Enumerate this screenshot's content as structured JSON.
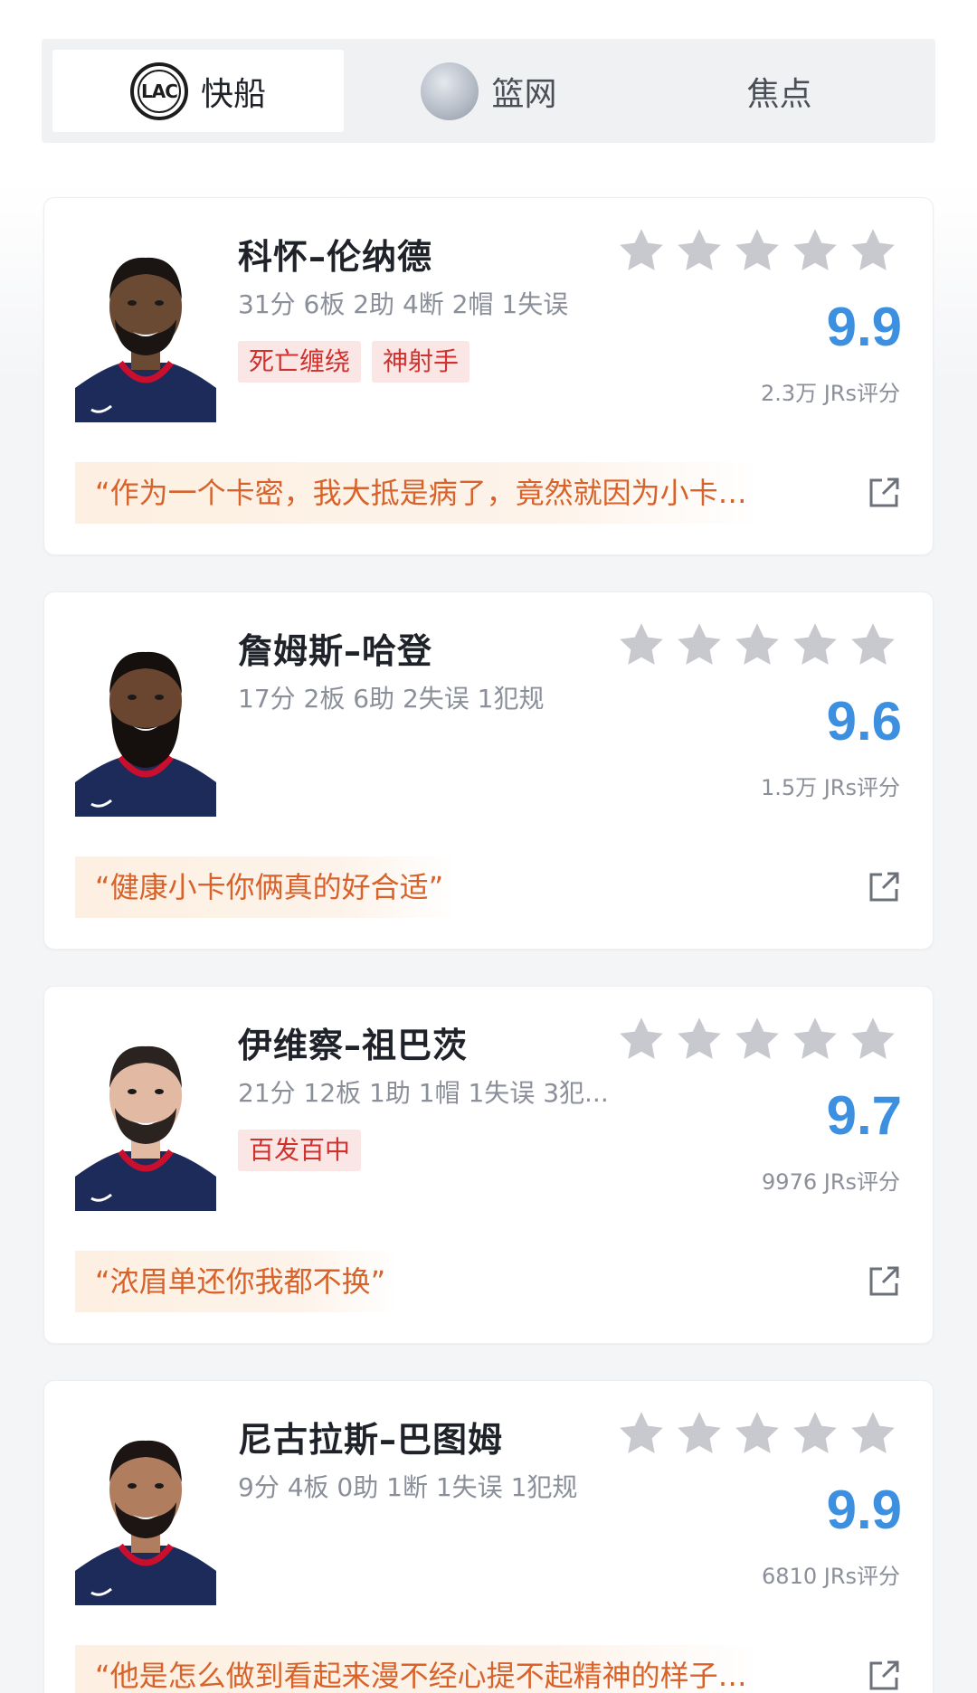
{
  "tabs": [
    {
      "label": "快船",
      "logo": "LAC",
      "active": true
    },
    {
      "label": "篮网",
      "logo": "",
      "active": false
    },
    {
      "label": "焦点",
      "logo": "",
      "active": false
    }
  ],
  "colors": {
    "score_blue": "#3d8fe0",
    "star_gray": "#c7c9ce",
    "tag_red": "#d0312d",
    "quote_orange": "#d8622a"
  },
  "players": [
    {
      "name": "科怀–伦纳德",
      "stats": "31分 6板 2助 4断 2帽 1失误",
      "tags": [
        "死亡缠绕",
        "神射手"
      ],
      "score": "9.9",
      "rating_count": "2.3万 JRs评分",
      "quote": "“作为一个卡密，我大抵是病了，竟然就因为小卡…",
      "stars_filled": 0
    },
    {
      "name": "詹姆斯–哈登",
      "stats": "17分 2板 6助 2失误 1犯规",
      "tags": [],
      "score": "9.6",
      "rating_count": "1.5万 JRs评分",
      "quote": "“健康小卡你俩真的好合适”",
      "stars_filled": 0
    },
    {
      "name": "伊维察–祖巴茨",
      "stats": "21分 12板 1助 1帽 1失误 3犯...",
      "tags": [
        "百发百中"
      ],
      "score": "9.7",
      "rating_count": "9976 JRs评分",
      "quote": "“浓眉单还你我都不换”",
      "stars_filled": 0
    },
    {
      "name": "尼古拉斯–巴图姆",
      "stats": "9分 4板 0助 1断 1失误 1犯规",
      "tags": [],
      "score": "9.9",
      "rating_count": "6810 JRs评分",
      "quote": "“他是怎么做到看起来漫不经心提不起精神的样子…",
      "stars_filled": 0
    }
  ]
}
